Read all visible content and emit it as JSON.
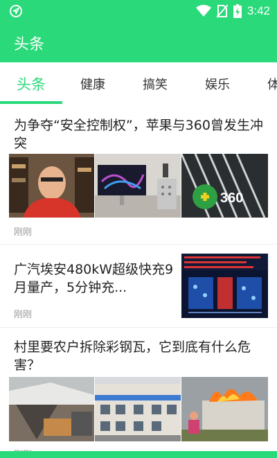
{
  "status_bar": {
    "time": "3:42",
    "icons": [
      "navigation-icon",
      "wifi-icon",
      "no-sim-icon",
      "battery-charging-icon"
    ]
  },
  "app_bar": {
    "title": "头条"
  },
  "tabs": [
    {
      "label": "头条",
      "active": true
    },
    {
      "label": "健康",
      "active": false
    },
    {
      "label": "搞笑",
      "active": false
    },
    {
      "label": "娱乐",
      "active": false
    },
    {
      "label": "体",
      "active": false
    }
  ],
  "feed": [
    {
      "title_line1": "为争夺“安全控制权”，苹果与360曾发生冲",
      "title_line2": "突",
      "time": "刚刚",
      "images": [
        "person-photo",
        "mac-pro-photo",
        "360-logo-photo"
      ]
    },
    {
      "title_line1": "广汽埃安480kW超级快充9",
      "title_line2": "月量产，5分钟充...",
      "time": "刚刚",
      "images": [
        "battery-diagram-photo"
      ]
    },
    {
      "title_line1": "村里要农户拆除彩钢瓦，它到底有什么危",
      "title_line2": "害？",
      "time": "刚刚",
      "images": [
        "ruins-photo",
        "building-photo",
        "fire-photo"
      ]
    }
  ],
  "colors": {
    "brand": "#2ad97a",
    "text": "#222222",
    "meta": "#999999"
  }
}
